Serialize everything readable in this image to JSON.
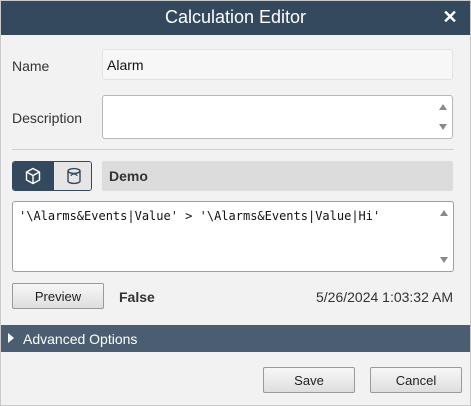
{
  "dialog": {
    "title": "Calculation Editor",
    "close_glyph": "✕"
  },
  "form": {
    "name_label": "Name",
    "name_value": "Alarm",
    "description_label": "Description",
    "description_value": ""
  },
  "toggle": {
    "left_icon": "cube-icon",
    "right_icon": "database-icon",
    "selected": "left"
  },
  "context": {
    "label": "Demo"
  },
  "formula": {
    "text": "'\\Alarms&Events|Value' > '\\Alarms&Events|Value|Hi'"
  },
  "preview": {
    "button_label": "Preview",
    "result": "False",
    "timestamp": "5/26/2024 1:03:32 AM"
  },
  "advanced": {
    "label": "Advanced Options"
  },
  "footer": {
    "save_label": "Save",
    "cancel_label": "Cancel"
  },
  "colors": {
    "titlebar": "#34495e",
    "advanced_bar": "#4b5d70"
  }
}
